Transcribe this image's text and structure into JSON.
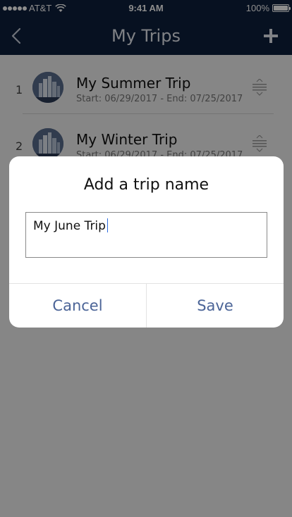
{
  "status_bar": {
    "carrier": "AT&T",
    "time": "9:41 AM",
    "battery": "100%"
  },
  "nav": {
    "title": "My Trips",
    "back_icon": "chevron-left-icon",
    "add_icon": "plus-icon"
  },
  "trips": [
    {
      "index": "1",
      "name": "My Summer Trip",
      "dates": "Start: 06/29/2017 - End: 07/25/2017"
    },
    {
      "index": "2",
      "name": "My Winter Trip",
      "dates": "Start: 06/29/2017 - End: 07/25/2017"
    }
  ],
  "dialog": {
    "title": "Add a trip name",
    "input_value": "My June Trip",
    "cancel_label": "Cancel",
    "save_label": "Save"
  },
  "colors": {
    "nav_background": "#0d1f3c",
    "dialog_button": "#4b6497",
    "overlay": "rgba(0,0,0,0.45)"
  }
}
